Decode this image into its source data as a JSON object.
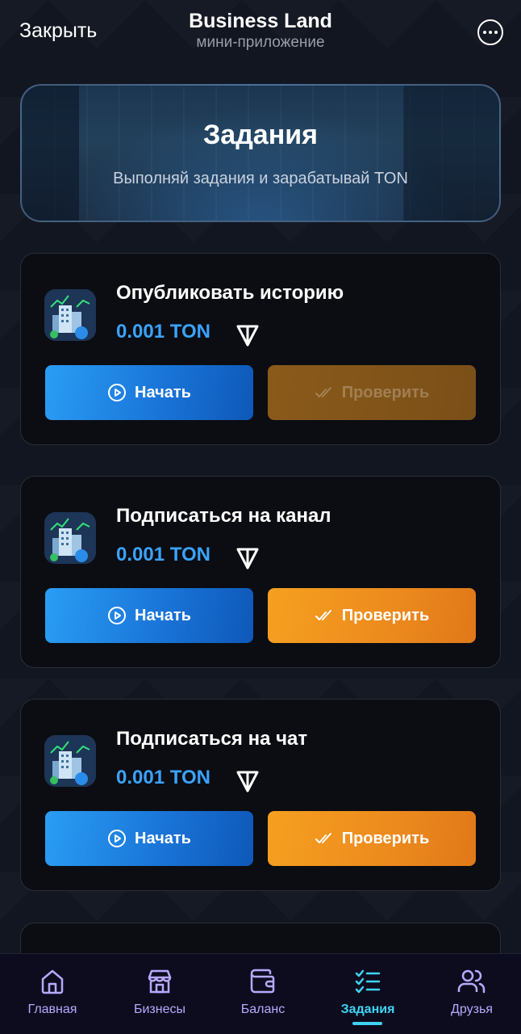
{
  "header": {
    "close_label": "Закрыть",
    "title": "Business Land",
    "subtitle": "мини-приложение",
    "more_icon": "more-horizontal-icon"
  },
  "hero": {
    "title": "Задания",
    "subtitle": "Выполняй задания и зарабатывай TON"
  },
  "tasks": [
    {
      "title": "Опубликовать историю",
      "reward": "0.001 TON",
      "start_label": "Начать",
      "check_label": "Проверить",
      "check_enabled": false
    },
    {
      "title": "Подписаться на канал",
      "reward": "0.001 TON",
      "start_label": "Начать",
      "check_label": "Проверить",
      "check_enabled": true
    },
    {
      "title": "Подписаться на чат",
      "reward": "0.001 TON",
      "start_label": "Начать",
      "check_label": "Проверить",
      "check_enabled": true
    }
  ],
  "nav": {
    "items": [
      {
        "label": "Главная",
        "icon": "home-icon"
      },
      {
        "label": "Бизнесы",
        "icon": "store-icon"
      },
      {
        "label": "Баланс",
        "icon": "wallet-icon"
      },
      {
        "label": "Задания",
        "icon": "tasks-icon"
      },
      {
        "label": "Друзья",
        "icon": "users-icon"
      }
    ],
    "active": "Задания"
  },
  "colors": {
    "accent_blue": "#2a9df4",
    "accent_orange": "#f09020",
    "reward_blue": "#3aa3ff",
    "nav_active": "#3fd3f3",
    "nav_inactive": "#b7a9ff"
  }
}
